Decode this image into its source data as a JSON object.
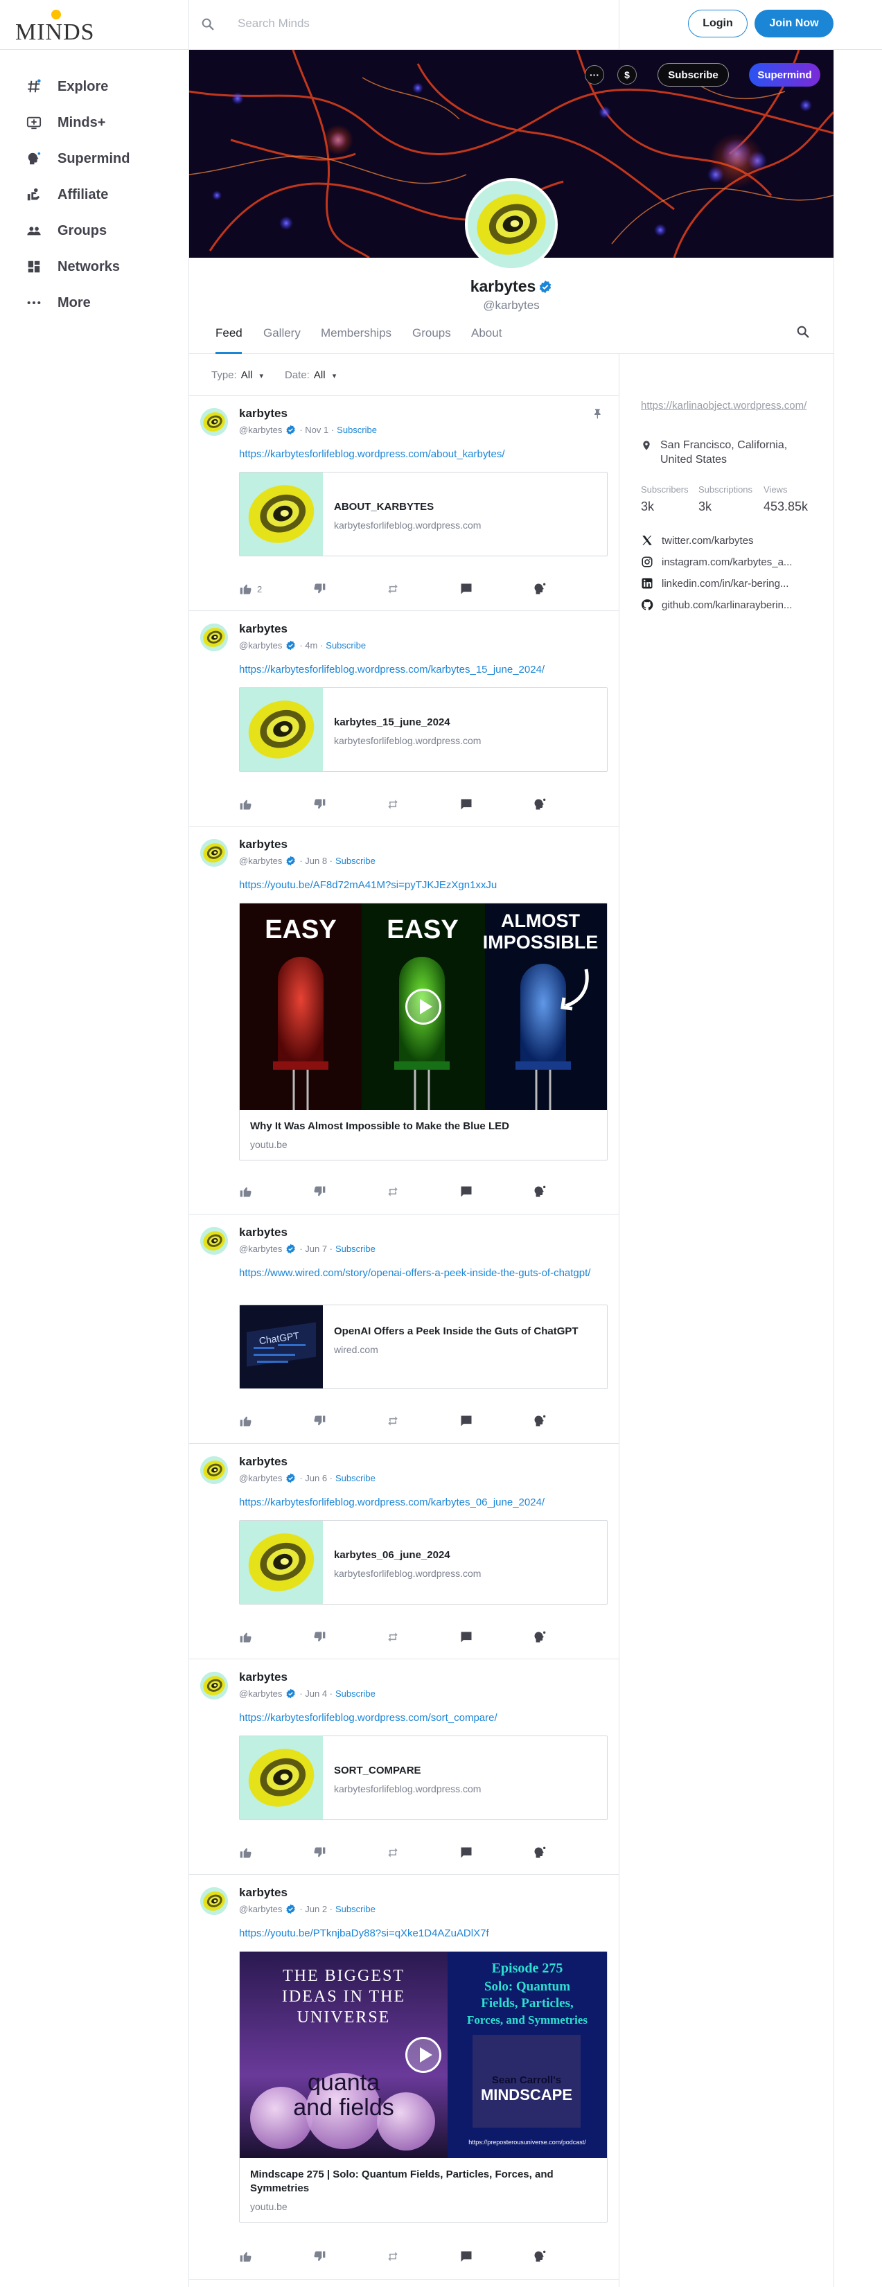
{
  "header": {
    "logo_text": "MINDS",
    "search_placeholder": "Search Minds",
    "login_label": "Login",
    "join_label": "Join Now"
  },
  "nav": [
    {
      "label": "Explore",
      "icon": "hashtag-icon"
    },
    {
      "label": "Minds+",
      "icon": "minds-plus-icon"
    },
    {
      "label": "Supermind",
      "icon": "supermind-icon"
    },
    {
      "label": "Affiliate",
      "icon": "affiliate-icon"
    },
    {
      "label": "Groups",
      "icon": "groups-icon"
    },
    {
      "label": "Networks",
      "icon": "networks-icon"
    },
    {
      "label": "More",
      "icon": "more-icon"
    }
  ],
  "banner": {
    "more_symbol": "···",
    "tip_symbol": "$",
    "subscribe_label": "Subscribe",
    "supermind_label": "Supermind"
  },
  "profile": {
    "name": "karbytes",
    "handle": "@karbytes"
  },
  "tabs": [
    "Feed",
    "Gallery",
    "Memberships",
    "Groups",
    "About"
  ],
  "filters": {
    "type_label": "Type:",
    "type_value": "All",
    "date_label": "Date:",
    "date_value": "All",
    "caret": "▾"
  },
  "sidebar": {
    "website": "https://karlinaobject.wordpress.com/",
    "location": "San Francisco, California, United States",
    "stats": [
      {
        "label": "Subscribers",
        "value": "3k"
      },
      {
        "label": "Subscriptions",
        "value": "3k"
      },
      {
        "label": "Views",
        "value": "453.85k"
      }
    ],
    "socials": [
      {
        "icon": "x-icon",
        "text": "twitter.com/karbytes"
      },
      {
        "icon": "instagram-icon",
        "text": "instagram.com/karbytes_a..."
      },
      {
        "icon": "linkedin-icon",
        "text": "linkedin.com/in/kar-bering..."
      },
      {
        "icon": "github-icon",
        "text": "github.com/karlinarayberin..."
      }
    ]
  },
  "posts": [
    {
      "name": "karbytes",
      "handle": "@karbytes",
      "date": "· Nov 1 ·",
      "subscribe": "Subscribe",
      "url": "https://karbytesforlifeblog.wordpress.com/about_karbytes/",
      "card_title": "ABOUT_KARBYTES",
      "card_domain": "karbytesforlifeblog.wordpress.com",
      "likes": "2",
      "pinned": true
    },
    {
      "name": "karbytes",
      "handle": "@karbytes",
      "date": "· 4m ·",
      "subscribe": "Subscribe",
      "url": "https://karbytesforlifeblog.wordpress.com/karbytes_15_june_2024/",
      "card_title": "karbytes_15_june_2024",
      "card_domain": "karbytesforlifeblog.wordpress.com"
    },
    {
      "name": "karbytes",
      "handle": "@karbytes",
      "date": "· Jun 8 ·",
      "subscribe": "Subscribe",
      "url": "https://youtu.be/AF8d72mA41M?si=pyTJKJEzXgn1xxJu",
      "card_title": "Why It Was Almost Impossible to Make the Blue LED",
      "card_domain": "youtu.be",
      "image_text": [
        "EASY",
        "EASY",
        "ALMOST",
        "IMPOSSIBLE"
      ]
    },
    {
      "name": "karbytes",
      "handle": "@karbytes",
      "date": "· Jun 7 ·",
      "subscribe": "Subscribe",
      "url": "https://www.wired.com/story/openai-offers-a-peek-inside-the-guts-of-chatgpt/",
      "card_title": "OpenAI Offers a Peek Inside the Guts of ChatGPT",
      "card_domain": "wired.com",
      "thumb_text": "ChatGPT"
    },
    {
      "name": "karbytes",
      "handle": "@karbytes",
      "date": "· Jun 6 ·",
      "subscribe": "Subscribe",
      "url": "https://karbytesforlifeblog.wordpress.com/karbytes_06_june_2024/",
      "card_title": "karbytes_06_june_2024",
      "card_domain": "karbytesforlifeblog.wordpress.com"
    },
    {
      "name": "karbytes",
      "handle": "@karbytes",
      "date": "· Jun 4 ·",
      "subscribe": "Subscribe",
      "url": "https://karbytesforlifeblog.wordpress.com/sort_compare/",
      "card_title": "SORT_COMPARE",
      "card_domain": "karbytesforlifeblog.wordpress.com"
    },
    {
      "name": "karbytes",
      "handle": "@karbytes",
      "date": "· Jun 2 ·",
      "subscribe": "Subscribe",
      "url": "https://youtu.be/PTknjbaDy88?si=qXke1D4AZuADlX7f",
      "card_title": "Mindscape 275 | Solo: Quantum Fields, Particles, Forces, and Symmetries",
      "card_domain": "youtu.be",
      "image_text": [
        "THE BIGGEST",
        "IDEAS IN THE",
        "UNIVERSE",
        "quanta",
        "and fields",
        "Episode 275",
        "Solo: Quantum",
        "Fields, Particles,",
        "Forces, and Symmetries",
        "Sean Carroll's",
        "MINDSCAPE",
        "https://preposterousuniverse.com/podcast/"
      ]
    }
  ],
  "colors": {
    "accent": "#1b85d6",
    "text": "#1d2125",
    "muted": "#7d8290",
    "border": "#e3e4e9"
  }
}
